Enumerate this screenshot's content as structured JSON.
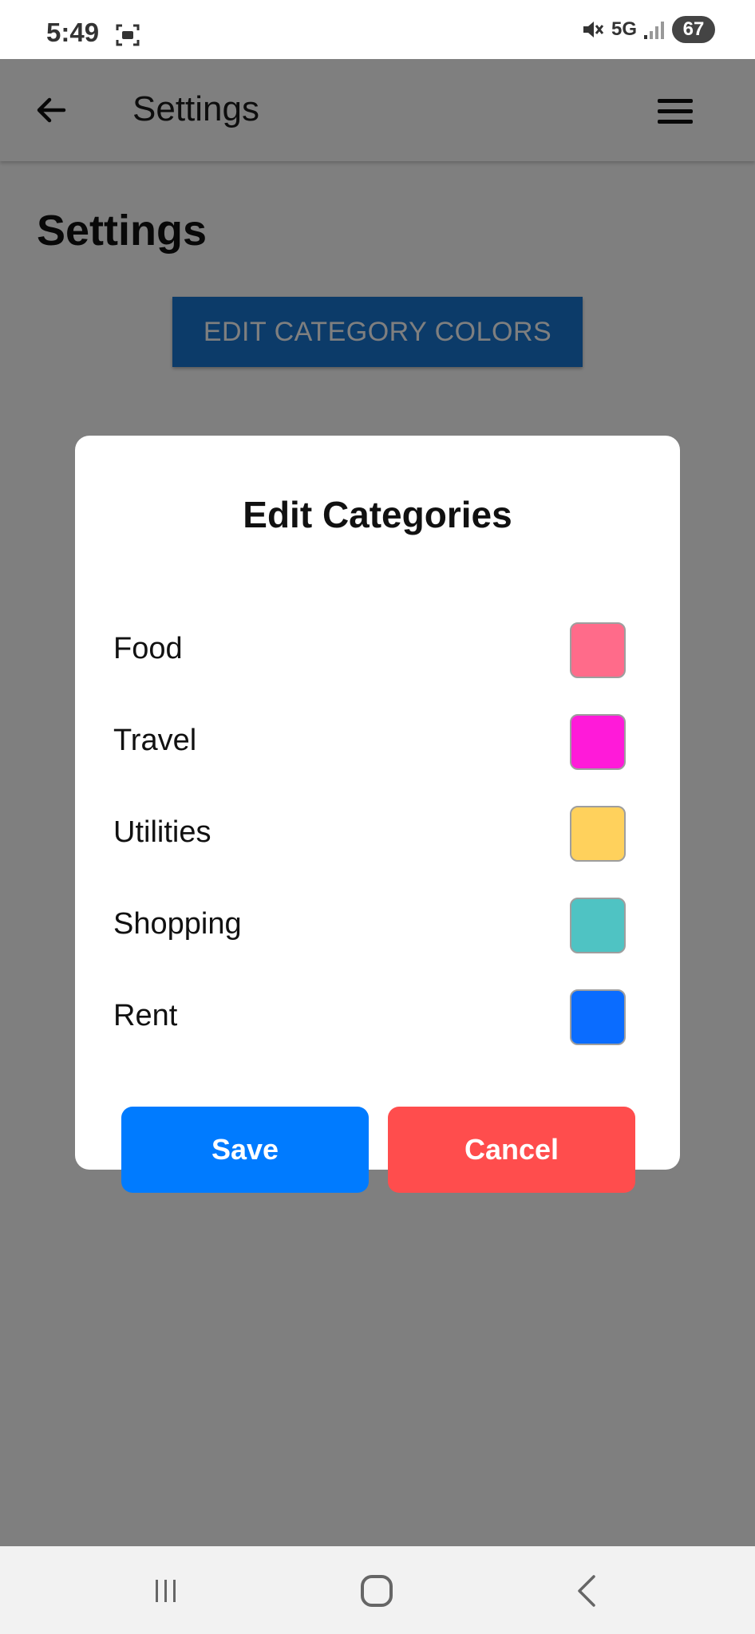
{
  "status_bar": {
    "time": "5:49",
    "network": "5G",
    "battery": "67"
  },
  "app_bar": {
    "title": "Settings"
  },
  "page": {
    "heading": "Settings",
    "edit_colors_button": "EDIT CATEGORY COLORS"
  },
  "dialog": {
    "title": "Edit Categories",
    "categories": [
      {
        "label": "Food",
        "color": "#ff6b8a"
      },
      {
        "label": "Travel",
        "color": "#ff1ad9"
      },
      {
        "label": "Utilities",
        "color": "#ffd15c"
      },
      {
        "label": "Shopping",
        "color": "#4fc3c3"
      },
      {
        "label": "Rent",
        "color": "#0a6cff"
      }
    ],
    "save_label": "Save",
    "cancel_label": "Cancel"
  },
  "colors": {
    "primary": "#1976d2",
    "save": "#007bff",
    "cancel": "#ff4d4d"
  },
  "icons": {
    "back": "back-arrow-icon",
    "menu": "hamburger-menu-icon",
    "mute": "mute-icon",
    "signal": "signal-icon",
    "screenshot": "screenshot-icon",
    "nav_recent": "recent-apps-icon",
    "nav_home": "home-icon",
    "nav_back": "nav-back-icon"
  }
}
